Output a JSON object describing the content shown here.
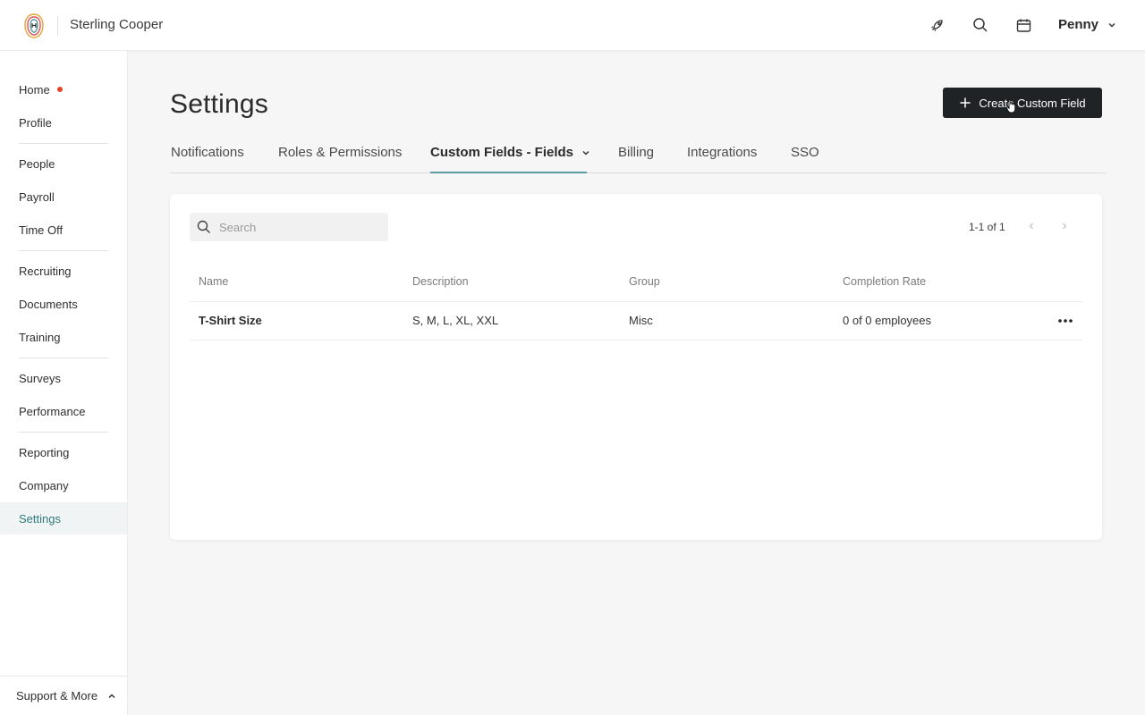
{
  "header": {
    "company_name": "Sterling Cooper",
    "user_name": "Penny",
    "icons": [
      "rocket-icon",
      "search-icon",
      "calendar-icon"
    ]
  },
  "sidebar": {
    "items": [
      {
        "label": "Home",
        "badge": "notification-dot"
      },
      {
        "label": "Profile"
      },
      {
        "label": "People"
      },
      {
        "label": "Payroll"
      },
      {
        "label": "Time Off"
      },
      {
        "label": "Recruiting"
      },
      {
        "label": "Documents"
      },
      {
        "label": "Training"
      },
      {
        "label": "Surveys"
      },
      {
        "label": "Performance"
      },
      {
        "label": "Reporting"
      },
      {
        "label": "Company"
      },
      {
        "label": "Settings",
        "active": true
      }
    ],
    "footer_label": "Support & More"
  },
  "page": {
    "title": "Settings",
    "create_button_label": "Create Custom Field"
  },
  "tabs": [
    {
      "label": "Notifications"
    },
    {
      "label": "Roles & Permissions"
    },
    {
      "label": "Custom Fields - Fields",
      "active": true
    },
    {
      "label": "Billing"
    },
    {
      "label": "Integrations"
    },
    {
      "label": "SSO"
    }
  ],
  "table": {
    "search_placeholder": "Search",
    "pagination": "1-1 of 1",
    "columns": [
      "Name",
      "Description",
      "Group",
      "Completion Rate"
    ],
    "rows": [
      {
        "name": "T-Shirt Size",
        "description": "S, M, L, XL, XXL",
        "group": "Misc",
        "completion_rate": "0 of 0 employees"
      }
    ]
  },
  "colors": {
    "accent": "#5b9aa0",
    "active_nav_text": "#2f7a78",
    "notification": "#e0452b",
    "primary_button": "#1f2326"
  }
}
